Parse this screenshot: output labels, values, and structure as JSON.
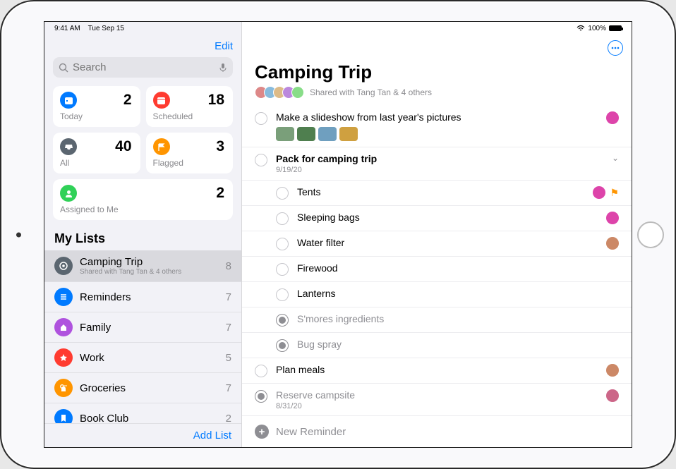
{
  "status": {
    "time": "9:41 AM",
    "date": "Tue Sep 15",
    "battery": "100%"
  },
  "sidebar": {
    "edit": "Edit",
    "search_placeholder": "Search",
    "cards": {
      "today": {
        "label": "Today",
        "count": "2",
        "color": "#007aff"
      },
      "scheduled": {
        "label": "Scheduled",
        "count": "18",
        "color": "#ff3b30"
      },
      "all": {
        "label": "All",
        "count": "40",
        "color": "#5b6670"
      },
      "flagged": {
        "label": "Flagged",
        "count": "3",
        "color": "#ff9500"
      },
      "assigned": {
        "label": "Assigned to Me",
        "count": "2",
        "color": "#30d158"
      }
    },
    "mylists_header": "My Lists",
    "lists": [
      {
        "name": "Camping Trip",
        "sub": "Shared with Tang Tan & 4 others",
        "count": "8",
        "color": "#5b6670",
        "selected": true
      },
      {
        "name": "Reminders",
        "count": "7",
        "color": "#007aff"
      },
      {
        "name": "Family",
        "count": "7",
        "color": "#af52de"
      },
      {
        "name": "Work",
        "count": "5",
        "color": "#ff3b30"
      },
      {
        "name": "Groceries",
        "count": "7",
        "color": "#ff9500"
      },
      {
        "name": "Book Club",
        "count": "2",
        "color": "#007aff"
      }
    ],
    "add_list": "Add List"
  },
  "main": {
    "title": "Camping Trip",
    "shared_text": "Shared with Tang Tan & 4 others",
    "avatars": [
      "#d88",
      "#8bd",
      "#db8",
      "#b8d",
      "#8d8"
    ],
    "new_reminder": "New Reminder",
    "reminders": [
      {
        "title": "Make a slideshow from last year's pictures",
        "assignee": "#d4a",
        "thumbs": [
          "#7a9f7a",
          "#4f7f4f",
          "#6f9fbf",
          "#cfa040"
        ]
      },
      {
        "title": "Pack for camping trip",
        "date": "9/19/20",
        "header": true,
        "expandable": true
      },
      {
        "title": "Tents",
        "sub": true,
        "assignee": "#d4a",
        "flagged": true
      },
      {
        "title": "Sleeping bags",
        "sub": true,
        "assignee": "#d4a"
      },
      {
        "title": "Water filter",
        "sub": true,
        "assignee": "#c86"
      },
      {
        "title": "Firewood",
        "sub": true
      },
      {
        "title": "Lanterns",
        "sub": true
      },
      {
        "title": "S'mores ingredients",
        "sub": true,
        "done": true
      },
      {
        "title": "Bug spray",
        "sub": true,
        "done": true
      },
      {
        "title": "Plan meals",
        "assignee": "#c86"
      },
      {
        "title": "Reserve campsite",
        "date": "8/31/20",
        "done": true,
        "assignee": "#c68"
      }
    ]
  }
}
